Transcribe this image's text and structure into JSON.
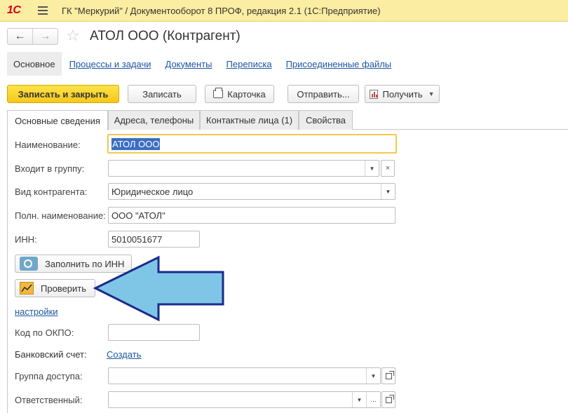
{
  "titlebar": {
    "logo": "1С",
    "title": "ГК \"Меркурий\" / Документооборот 8 ПРОФ, редакция 2.1  (1С:Предприятие)"
  },
  "header": {
    "back": "←",
    "forward": "→",
    "star": "☆",
    "title": "АТОЛ ООО (Контрагент)"
  },
  "navtabs": {
    "main": "Основное",
    "links": [
      "Процессы и задачи",
      "Документы",
      "Переписка",
      "Присоединенные файлы"
    ]
  },
  "commands": {
    "save_close": "Записать и закрыть",
    "save": "Записать",
    "card": "Карточка",
    "send": "Отправить...",
    "get": "Получить"
  },
  "tabs": [
    "Основные сведения",
    "Адреса, телефоны",
    "Контактные лица (1)",
    "Свойства"
  ],
  "form": {
    "name_label": "Наименование:",
    "name_value": "АТОЛ ООО",
    "group_label": "Входит в группу:",
    "group_value": "",
    "kind_label": "Вид контрагента:",
    "kind_value": "Юридическое лицо",
    "fullname_label": "Полн. наименование:",
    "fullname_value": "ООО \"АТОЛ\"",
    "inn_label": "ИНН:",
    "inn_value": "5010051677",
    "fill_by_inn": "Заполнить по ИНН",
    "check": "Проверить",
    "settings_link": "настройки",
    "okpo_label": "Код по ОКПО:",
    "okpo_value": "",
    "bank_label": "Банковский счет:",
    "bank_create": "Создать",
    "access_label": "Группа доступа:",
    "access_value": "",
    "responsible_label": "Ответственный:",
    "responsible_value": ""
  },
  "glyphs": {
    "dropdown": "▼",
    "clear": "×",
    "dots": "..."
  },
  "colors": {
    "titlebar": "#fbeda1",
    "primary_button": "#f6c818",
    "link": "#1d56a0",
    "arrow_fill": "#7fc6e6",
    "arrow_stroke": "#1a2a8c"
  }
}
